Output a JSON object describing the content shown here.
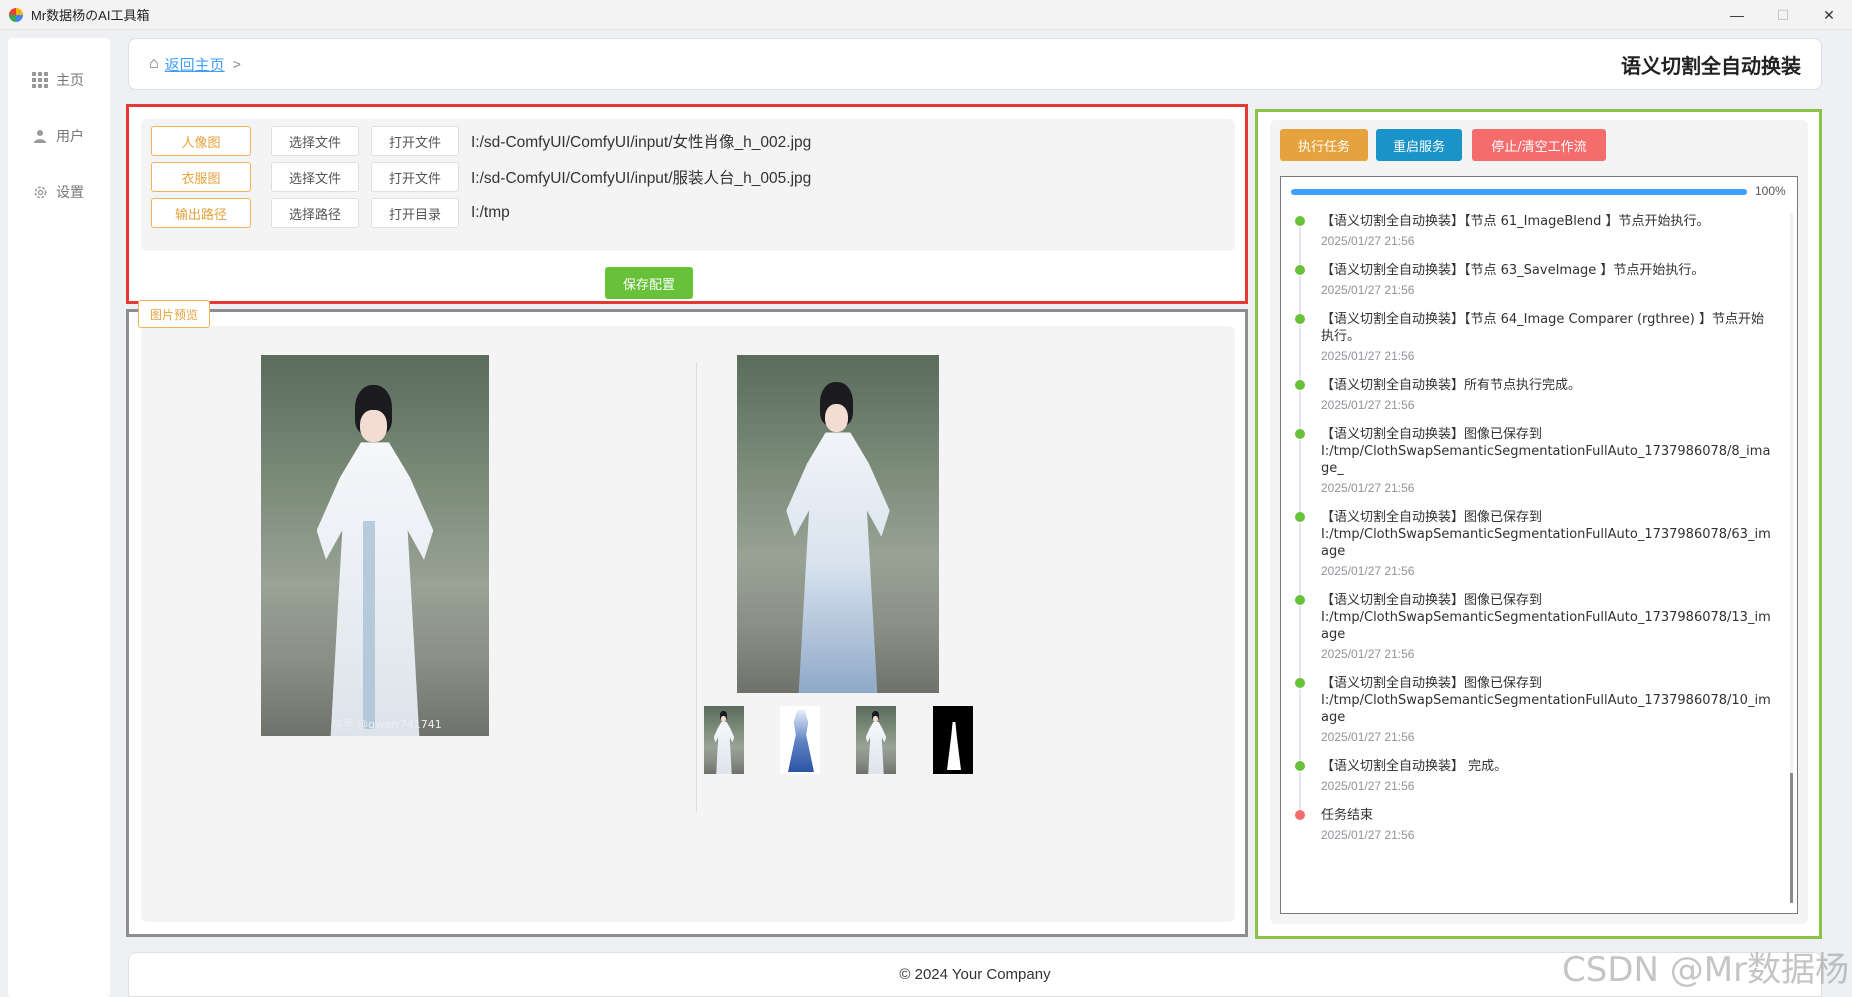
{
  "window": {
    "title": "Mr数据杨のAI工具箱",
    "minimize": "—",
    "maximize": "☐",
    "close": "✕"
  },
  "sidebar": {
    "items": [
      {
        "label": "主页",
        "icon": "grid-icon"
      },
      {
        "label": "用户",
        "icon": "user-icon"
      },
      {
        "label": "设置",
        "icon": "gear-icon"
      }
    ]
  },
  "header": {
    "back_label": "返回主页",
    "separator": ">",
    "page_title": "语义切割全自动换装"
  },
  "config": {
    "rows": [
      {
        "tag": "人像图",
        "btn1": "选择文件",
        "btn2": "打开文件",
        "path": "I:/sd-ComfyUI/ComfyUI/input/女性肖像_h_002.jpg"
      },
      {
        "tag": "衣服图",
        "btn1": "选择文件",
        "btn2": "打开文件",
        "path": "I:/sd-ComfyUI/ComfyUI/input/服装人台_h_005.jpg"
      },
      {
        "tag": "输出路径",
        "btn1": "选择路径",
        "btn2": "打开目录",
        "path": "I:/tmp"
      }
    ],
    "save_label": "保存配置"
  },
  "preview": {
    "tag": "图片预览",
    "watermark": "快手 @qwerr741741"
  },
  "task": {
    "run_label": "执行任务",
    "restart_label": "重启服务",
    "stop_label": "停止/清空工作流",
    "progress": 100,
    "progress_text": "100%",
    "logs": [
      {
        "text": "【语义切割全自动换装】【节点 61_ImageBlend 】节点开始执行。",
        "time": "2025/01/27 21:56",
        "status": "green"
      },
      {
        "text": "【语义切割全自动换装】【节点 63_SaveImage 】节点开始执行。",
        "time": "2025/01/27 21:56",
        "status": "green"
      },
      {
        "text": "【语义切割全自动换装】【节点 64_Image Comparer (rgthree) 】节点开始执行。",
        "time": "2025/01/27 21:56",
        "status": "green"
      },
      {
        "text": "【语义切割全自动换装】所有节点执行完成。",
        "time": "2025/01/27 21:56",
        "status": "green"
      },
      {
        "text": "【语义切割全自动换装】图像已保存到\nI:/tmp/ClothSwapSemanticSegmentationFullAuto_1737986078/8_image_",
        "time": "2025/01/27 21:56",
        "status": "green"
      },
      {
        "text": "【语义切割全自动换装】图像已保存到\nI:/tmp/ClothSwapSemanticSegmentationFullAuto_1737986078/63_image",
        "time": "2025/01/27 21:56",
        "status": "green"
      },
      {
        "text": "【语义切割全自动换装】图像已保存到\nI:/tmp/ClothSwapSemanticSegmentationFullAuto_1737986078/13_image",
        "time": "2025/01/27 21:56",
        "status": "green"
      },
      {
        "text": "【语义切割全自动换装】图像已保存到\nI:/tmp/ClothSwapSemanticSegmentationFullAuto_1737986078/10_image",
        "time": "2025/01/27 21:56",
        "status": "green"
      },
      {
        "text": "【语义切割全自动换装】 完成。",
        "time": "2025/01/27 21:56",
        "status": "green"
      },
      {
        "text": "任务结束",
        "time": "2025/01/27 21:56",
        "status": "red"
      }
    ]
  },
  "footer": {
    "copyright": "© 2024 Your Company"
  },
  "watermark": "CSDN @Mr数据杨",
  "colors": {
    "config_border": "#e53935",
    "preview_border": "#8e8e8e",
    "task_border": "#8bc34a",
    "accent_blue": "#409eff",
    "success_green": "#67c23a",
    "warning_orange": "#e6a23c",
    "danger_red": "#f56c6c"
  }
}
